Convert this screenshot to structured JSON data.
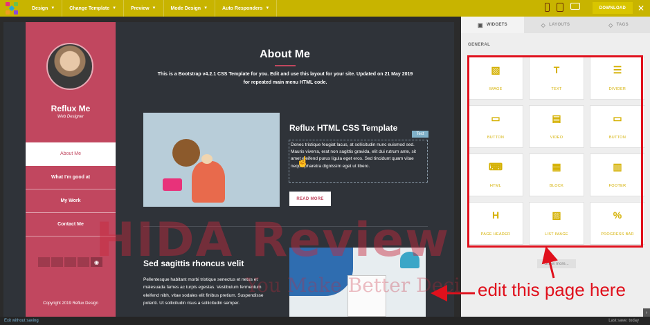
{
  "topbar": {
    "menu": [
      {
        "label": "Design"
      },
      {
        "label": "Change Template"
      },
      {
        "label": "Preview"
      },
      {
        "label": "Mode Design"
      },
      {
        "label": "Auto Responders"
      }
    ],
    "download_label": "DOWNLOAD",
    "close_label": "✕",
    "devices": [
      "phone-icon",
      "tablet-icon",
      "desktop-icon"
    ]
  },
  "site": {
    "brand_name": "Reflux Me",
    "brand_role": "Web Designer",
    "nav": [
      "About Me",
      "What I'm good at",
      "My Work",
      "Contact Me"
    ],
    "copyright": "Copyright 2019 Reflux Design",
    "page_title": "About Me",
    "intro": "This is a Bootstrap v4.2.1 CSS Template for you. Edit and use this layout for your site. Updated on 21 May 2019 for repeated main menu HTML code.",
    "section1": {
      "title": "Reflux HTML CSS Template",
      "tag": "Text",
      "text": "Donec tristique feugiat lacus, at sollicitudin nunc euismod sed. Mauris viverra, erat non sagittis gravida, elit dui rutrum ante, sit amet eleifend purus ligula eget eros. Sed tincidunt quam vitae neque pharetra dignissim eget ut libero.",
      "button": "READ MORE"
    },
    "section2": {
      "title": "Sed sagittis rhoncus velit",
      "text": "Pellentesque habitant morbi tristique senectus et netus et malesuada fames ac turpis egestas. Vestibulum fermentum eleifend nibh, vitae sodales elit finibus pretium. Suspendisse potenti. Ut sollicitudin risus a sollicitudin semper."
    }
  },
  "watermark": {
    "main": "HIDA Review",
    "sub": "You Make Better Decisions"
  },
  "panel": {
    "tabs": [
      {
        "label": "WIDGETS",
        "icon": "widgets-icon"
      },
      {
        "label": "LAYOUTS",
        "icon": "tag-icon"
      },
      {
        "label": "TAGS",
        "icon": "tag-icon"
      }
    ],
    "section_label": "GENERAL",
    "widgets": [
      {
        "label": "IMAGE",
        "icon": "image-icon"
      },
      {
        "label": "TEXT",
        "icon": "text-icon"
      },
      {
        "label": "DIVIDER",
        "icon": "divider-icon"
      },
      {
        "label": "BUTTON",
        "icon": "button-icon"
      },
      {
        "label": "VIDEO",
        "icon": "video-icon"
      },
      {
        "label": "BUTTON",
        "icon": "button-icon"
      },
      {
        "label": "HTML",
        "icon": "html-icon"
      },
      {
        "label": "BLOCK",
        "icon": "block-icon"
      },
      {
        "label": "FOOTER",
        "icon": "footer-icon"
      },
      {
        "label": "PAGE HEADER",
        "icon": "page-header-icon"
      },
      {
        "label": "LIST IMAGE",
        "icon": "list-image-icon"
      },
      {
        "label": "PROGRESS BAR",
        "icon": "progress-bar-icon"
      }
    ],
    "show_more": "Show more..."
  },
  "annotation": {
    "text": "edit this page here",
    "color": "#e0101c"
  },
  "bottombar": {
    "exit_label": "Exit without saving",
    "last_save": "Last save: today"
  },
  "colors": {
    "topbar": "#c8b400",
    "accent": "#c1475f",
    "widget_icon": "#d4b000"
  }
}
